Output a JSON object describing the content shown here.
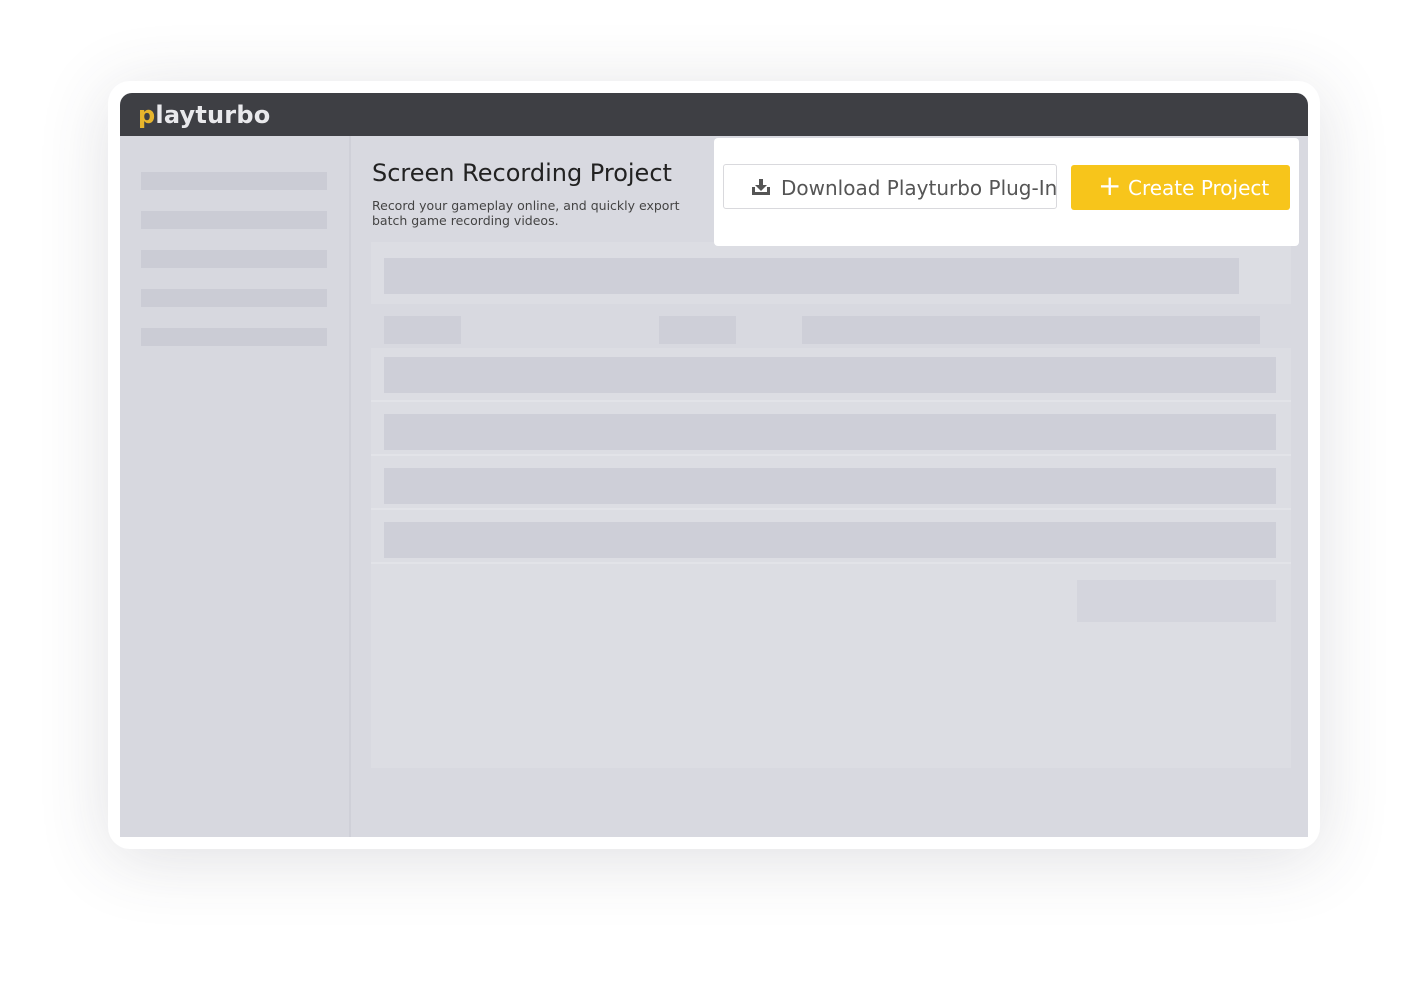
{
  "app": {
    "logo_first_letter": "p",
    "logo_rest": "layturbo"
  },
  "page": {
    "title": "Screen Recording Project",
    "subtitle": "Record your gameplay online, and quickly export batch game recording videos."
  },
  "actions": {
    "download_label": "Download Playturbo Plug-In",
    "download_icon": "download-tray-icon",
    "create_label": "Create Project",
    "create_icon": "plus-icon"
  },
  "colors": {
    "accent": "#f7c51b",
    "topbar": "#3e3f44",
    "overlay": "#d8d9e0"
  }
}
